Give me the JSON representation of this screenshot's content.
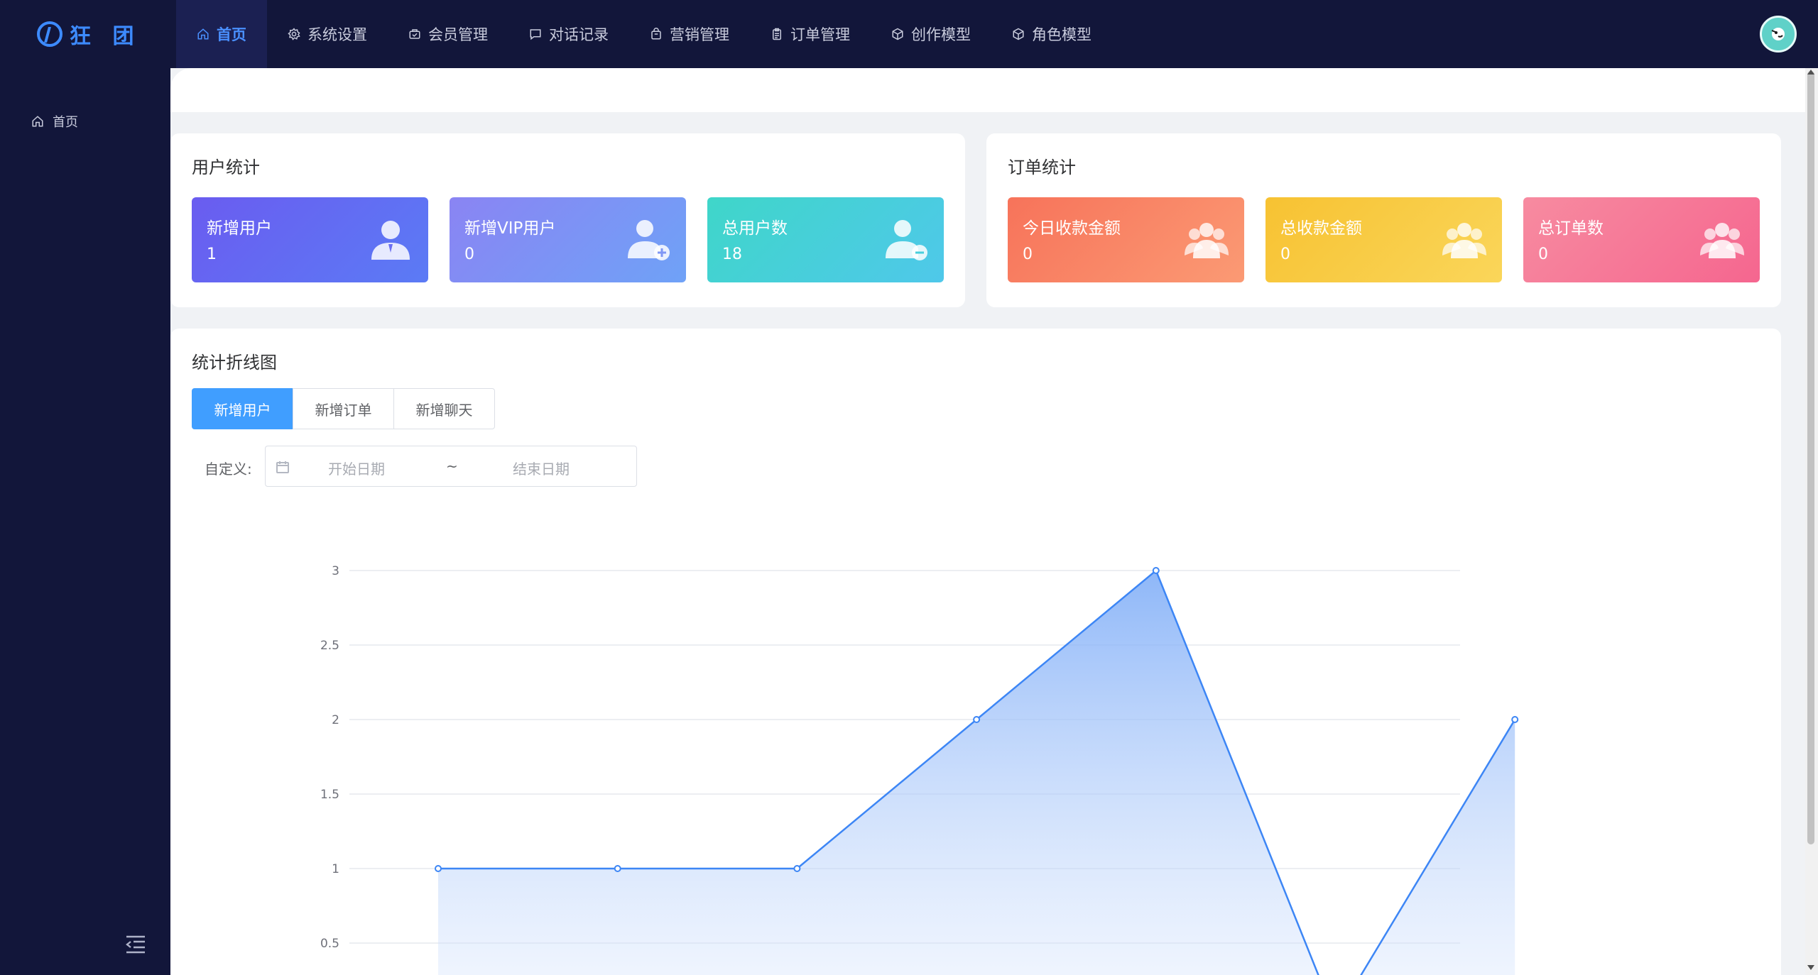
{
  "logo": {
    "text": "狂 团"
  },
  "nav": {
    "items": [
      {
        "label": "首页",
        "icon": "home-icon",
        "active": true
      },
      {
        "label": "系统设置",
        "icon": "gear-icon"
      },
      {
        "label": "会员管理",
        "icon": "member-icon"
      },
      {
        "label": "对话记录",
        "icon": "chat-icon"
      },
      {
        "label": "营销管理",
        "icon": "bag-icon"
      },
      {
        "label": "订单管理",
        "icon": "clipboard-icon"
      },
      {
        "label": "创作模型",
        "icon": "cube-icon"
      },
      {
        "label": "角色模型",
        "icon": "box-icon"
      }
    ]
  },
  "sidebar": {
    "items": [
      {
        "label": "首页",
        "icon": "home-icon"
      }
    ]
  },
  "user_stats": {
    "title": "用户统计",
    "cards": [
      {
        "label": "新增用户",
        "value": "1",
        "icon": "user-icon"
      },
      {
        "label": "新增VIP用户",
        "value": "0",
        "icon": "user-add-icon"
      },
      {
        "label": "总用户数",
        "value": "18",
        "icon": "user-remove-icon"
      }
    ]
  },
  "order_stats": {
    "title": "订单统计",
    "cards": [
      {
        "label": "今日收款金额",
        "value": "0",
        "icon": "group-icon"
      },
      {
        "label": "总收款金额",
        "value": "0",
        "icon": "group-icon"
      },
      {
        "label": "总订单数",
        "value": "0",
        "icon": "group-icon"
      }
    ]
  },
  "line_chart_panel": {
    "title": "统计折线图",
    "tabs": [
      "新增用户",
      "新增订单",
      "新增聊天"
    ],
    "active_tab": 0,
    "date_label": "自定义:",
    "start_placeholder": "开始日期",
    "separator": "~",
    "end_placeholder": "结束日期"
  },
  "colors": {
    "nav_bg": "#12163a",
    "accent": "#409eff",
    "line": "#3d86f5"
  },
  "chart_data": {
    "type": "area",
    "x": [
      "",
      "",
      "",
      "",
      "",
      "",
      ""
    ],
    "series": [
      {
        "values": [
          1,
          1,
          1,
          2,
          3,
          0,
          2
        ]
      }
    ],
    "yticks": [
      0.5,
      1,
      1.5,
      2,
      2.5,
      3
    ],
    "ylim": [
      0,
      3
    ],
    "grid": true
  }
}
